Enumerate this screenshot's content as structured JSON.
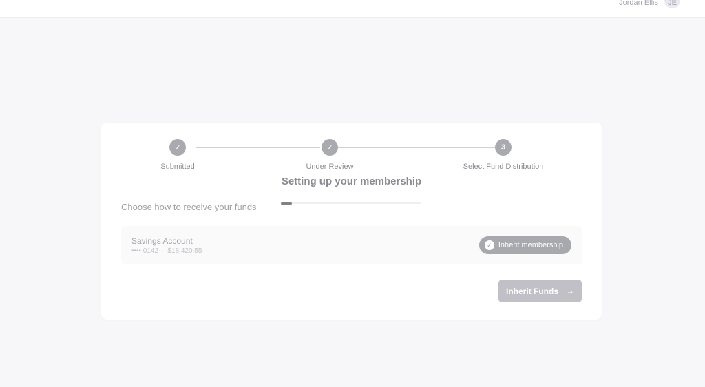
{
  "header": {
    "user_name": "Jordan Ellis",
    "avatar_initials": "JE"
  },
  "stepper": {
    "steps": [
      {
        "label": "Submitted",
        "marker": "✓",
        "state": "complete"
      },
      {
        "label": "Under Review",
        "marker": "✓",
        "state": "complete"
      },
      {
        "label": "Select Fund Distribution",
        "marker": "3",
        "state": "current"
      }
    ]
  },
  "overlay": {
    "title": "Setting up your membership",
    "progress_fraction": 0.08
  },
  "section": {
    "heading": "Choose how to receive your funds"
  },
  "account": {
    "name": "Savings Account",
    "masked_number": "•••• 0142",
    "separator": "·",
    "balance": "$18,420.55",
    "badge_label": "Inherit membership",
    "badge_icon": "check-icon"
  },
  "actions": {
    "primary_label": "Inherit Funds",
    "primary_arrow": "→"
  },
  "colors": {
    "background": "#f7f7f9",
    "card": "#ffffff",
    "step_complete": "#a9a9b0",
    "button": "#c0c0c6"
  }
}
